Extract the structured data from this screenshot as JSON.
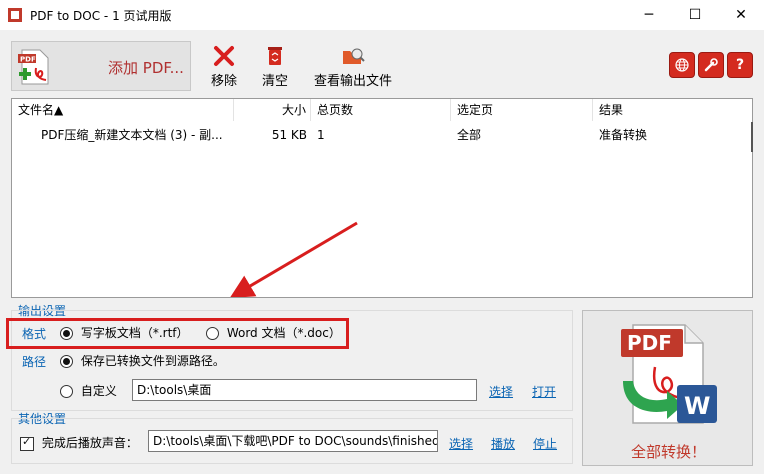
{
  "window": {
    "title": "PDF to DOC - 1 页试用版",
    "controls": {
      "minimize": "─",
      "maximize": "☐",
      "close": "✕"
    }
  },
  "toolbar": {
    "add_pdf_label": "添加 PDF...",
    "remove_label": "移除",
    "clear_label": "清空",
    "view_output_label": "查看输出文件",
    "round_buttons": [
      "web-icon",
      "settings-icon",
      "help-icon"
    ],
    "help_glyph": "?"
  },
  "file_table": {
    "columns": [
      "文件名▲",
      "大小",
      "总页数",
      "选定页",
      "结果"
    ],
    "rows": [
      {
        "name": "PDF压缩_新建文本文档 (3) - 副...",
        "size": "51 KB",
        "pages": "1",
        "selected_pages": "全部",
        "result": "准备转换"
      }
    ]
  },
  "output_settings": {
    "section_title": "输出设置",
    "format_label": "格式",
    "format_options": [
      {
        "label": "写字板文档（*.rtf）",
        "selected": true
      },
      {
        "label": "Word 文档（*.doc）",
        "selected": false
      }
    ],
    "path_label": "路径",
    "path_options": [
      {
        "label": "保存已转换文件到源路径。",
        "selected": true
      },
      {
        "label": "自定义",
        "selected": false
      }
    ],
    "custom_path_value": "D:\\tools\\桌面",
    "select_link": "选择",
    "open_link": "打开"
  },
  "other_settings": {
    "section_title": "其他设置",
    "play_sound_label": "完成后播放声音：",
    "play_sound_checked": true,
    "sound_path_value": "D:\\tools\\桌面\\下载吧\\PDF to DOC\\sounds\\finished.w",
    "select_link": "选择",
    "play_link": "播放",
    "stop_link": "停止"
  },
  "convert": {
    "label": "全部转换！",
    "icon_text": "PDF"
  },
  "colors": {
    "accent_blue": "#0a64b3",
    "highlight_red": "#d81e1e",
    "brand_red": "#c0392b"
  }
}
